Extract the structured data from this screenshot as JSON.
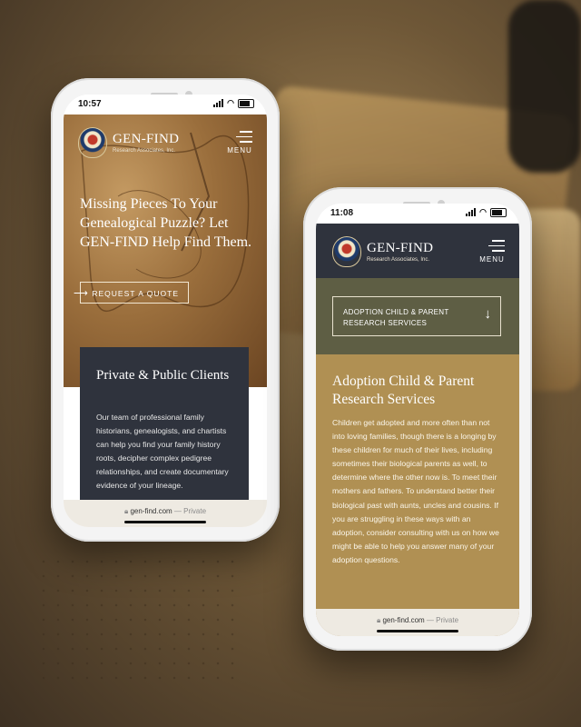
{
  "brand": {
    "title": "GEN-FIND",
    "subtitle": "Research Associates, Inc.",
    "menu_label": "MENU"
  },
  "phone1": {
    "time": "10:57",
    "hero_heading": "Missing Pieces To Your Genealogical Puzzle? Let GEN-FIND Help Find Them.",
    "cta_label": "REQUEST A QUOTE",
    "card_title": "Private & Public Clients",
    "card_body": "Our team of professional family historians, genealogists, and chartists can help you find your family history roots, decipher complex pedigree relationships, and create documentary evidence of your lineage.",
    "url": "gen-find.com",
    "url_suffix": "— Private",
    "colors": {
      "card_bg": "#2f333d",
      "map_bg": "#9a6e3c"
    }
  },
  "phone2": {
    "time": "11:08",
    "dropdown_label": "ADOPTION CHILD & PARENT RESEARCH SERVICES",
    "section_title": "Adoption Child & Parent Research Services",
    "section_body": "Children get adopted and more often than not into loving families, though there is a longing by these children for much of their lives, including sometimes their biological parents as well, to determine where the other now is.  To meet their mothers and fathers. To understand better their biological past with aunts, uncles and cousins. If you are struggling in these ways with an adoption, consider consulting with us on how we might be able to help you answer many of your adoption questions.",
    "url": "gen-find.com",
    "url_suffix": "— Private",
    "colors": {
      "header_bg": "#2f333d",
      "olive": "#5e5e44",
      "gold": "#b09053"
    }
  }
}
